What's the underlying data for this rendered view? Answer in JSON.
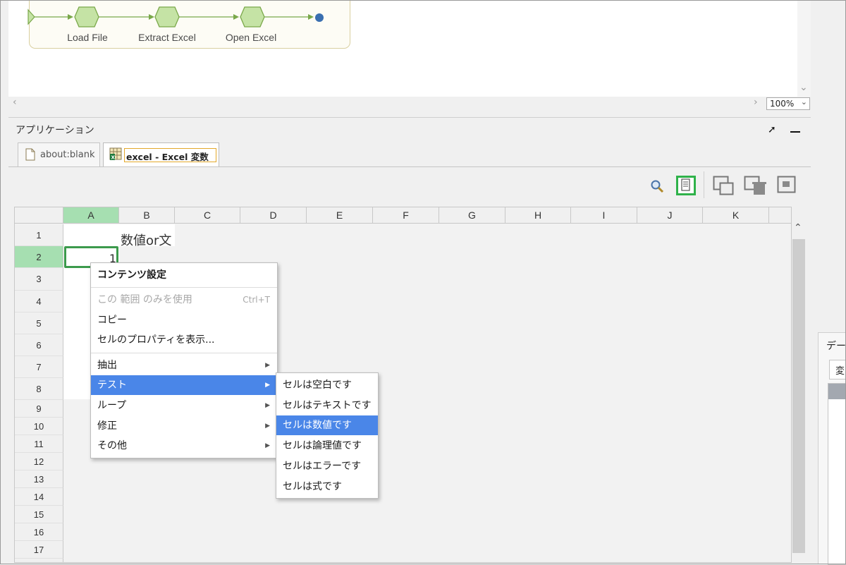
{
  "workflow": {
    "nodes": [
      {
        "label": "Load File"
      },
      {
        "label": "Extract Excel"
      },
      {
        "label": "Open Excel"
      }
    ],
    "zoom": "100%"
  },
  "app_panel": {
    "title": "アプリケーション",
    "tabs": [
      {
        "label": "about:blank",
        "icon": "document-icon",
        "active": false
      },
      {
        "label": "excel - Excel 変数",
        "icon": "excel-sheet-icon",
        "active": true
      }
    ]
  },
  "toolbar": {
    "icons": [
      "search-icon",
      "content-settings-icon",
      "copy-window-icon",
      "delete-window-icon",
      "capture-icon"
    ]
  },
  "sheet": {
    "columns": [
      "A",
      "B",
      "C",
      "D",
      "E",
      "F",
      "G",
      "H",
      "I",
      "J",
      "K"
    ],
    "selected_column": "A",
    "rows": [
      "1",
      "2",
      "3",
      "4",
      "5",
      "6",
      "7",
      "8",
      "9",
      "10",
      "11",
      "12",
      "13",
      "14",
      "15",
      "16",
      "17"
    ],
    "selected_row": "2",
    "cells": {
      "B1": "数値or文",
      "A2": "1"
    }
  },
  "context_menu": {
    "header": "コンテンツ設定",
    "items": [
      {
        "label": "この 範囲 のみを使用",
        "shortcut": "Ctrl+T",
        "disabled": true
      },
      {
        "label": "コピー"
      },
      {
        "label": "セルのプロパティを表示..."
      },
      {
        "label": "抽出",
        "submenu": true
      },
      {
        "label": "テスト",
        "submenu": true,
        "highlighted": true
      },
      {
        "label": "ループ",
        "submenu": true
      },
      {
        "label": "修正",
        "submenu": true
      },
      {
        "label": "その他",
        "submenu": true
      }
    ]
  },
  "submenu": {
    "items": [
      {
        "label": "セルは空白です"
      },
      {
        "label": "セルはテキストです"
      },
      {
        "label": "セルは数値です",
        "highlighted": true
      },
      {
        "label": "セルは論理値です"
      },
      {
        "label": "セルはエラーです"
      },
      {
        "label": "セルは式です"
      }
    ]
  },
  "right_pane": {
    "label": "デー",
    "tab": "変"
  },
  "colors": {
    "highlight": "#4a86e8",
    "selection_green": "#a6dfb1",
    "cell_border_green": "#3c9a4c",
    "flow_node": "#c5e3a5",
    "flow_line": "#7aa84a"
  }
}
